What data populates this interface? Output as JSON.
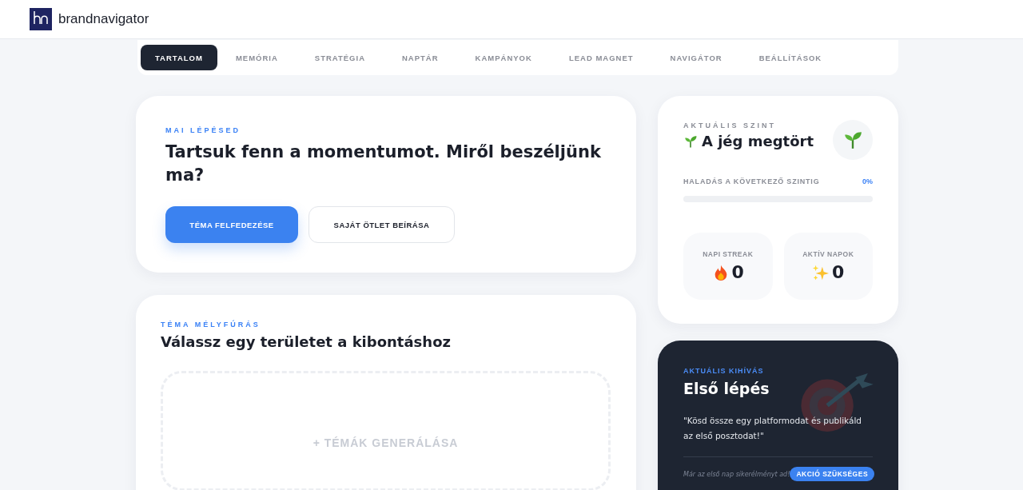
{
  "header": {
    "brand": "brandnavigator"
  },
  "tabs": [
    {
      "label": "TARTALOM",
      "selected": true
    },
    {
      "label": "MEMÓRIA",
      "selected": false
    },
    {
      "label": "STRATÉGIA",
      "selected": false
    },
    {
      "label": "NAPTÁR",
      "selected": false
    },
    {
      "label": "KAMPÁNYOK",
      "selected": false
    },
    {
      "label": "LEAD MAGNET",
      "selected": false
    },
    {
      "label": "NAVIGÁTOR",
      "selected": false
    },
    {
      "label": "BEÁLLÍTÁSOK",
      "selected": false
    }
  ],
  "today": {
    "eyebrow": "MAI LÉPÉSED",
    "title": "Tartsuk fenn a momentumot. Miről beszéljünk ma?",
    "primary_button": "TÉMA FELFEDEZÉSE",
    "secondary_button": "SAJÁT ÖTLET BEÍRÁSA"
  },
  "deep_dive": {
    "eyebrow": "TÉMA MÉLYFÚRÁS",
    "title": "Válassz egy területet a kibontáshoz",
    "generate_button": "+ TÉMÁK GENERÁLÁSA"
  },
  "level": {
    "eyebrow": "AKTUÁLIS SZINT",
    "name": "A jég megtört",
    "progress_label": "HALADÁS A KÖVETKEZŐ SZINTIG",
    "progress_value": "0%",
    "level": 0,
    "stats": [
      {
        "label": "NAPI STREAK",
        "value": "0",
        "kind": "fire"
      },
      {
        "label": "AKTÍV NAPOK",
        "value": "0",
        "kind": "sparkles"
      }
    ]
  },
  "challenge": {
    "eyebrow": "AKTUÁLIS KIHÍVÁS",
    "title": "Első lépés",
    "quote": "\"Kösd össze egy platformodat és publikáld az első posztodat!\"",
    "note": "Már az első nap sikerélményt ad!",
    "badge": "AKCIÓ SZÜKSÉGES"
  }
}
